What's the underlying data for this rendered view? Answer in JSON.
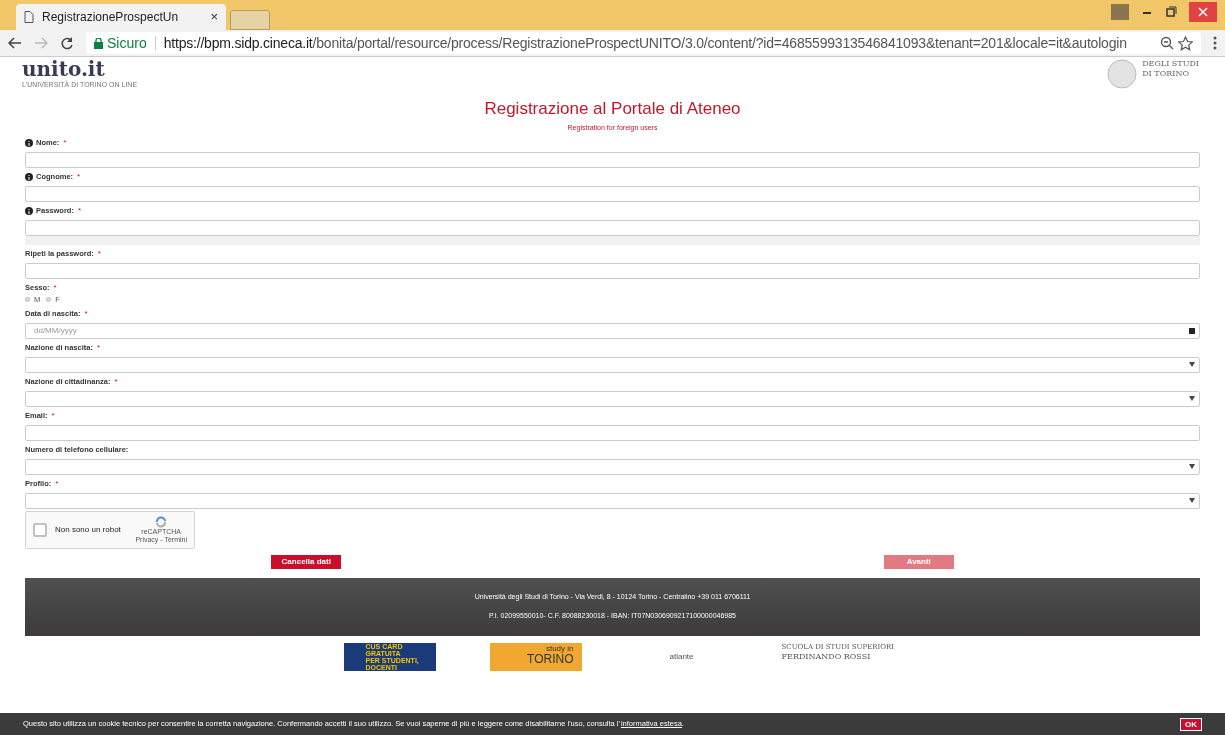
{
  "browser": {
    "tab_title": "RegistrazioneProspectUn",
    "tab_close": "×",
    "secure_label": "Sicuro",
    "url_host": "https://bpm.sidp.cineca.it",
    "url_path": "/bonita/portal/resource/process/RegistrazioneProspectUNITO/3.0/content/?id=4685599313546841093&tenant=201&locale=it&autologin"
  },
  "header": {
    "logo": "unito.it",
    "logo_tagline": "L'UNIVERSITÀ DI TORINO ON LINE",
    "university_lines": [
      "DEGLI STUDI",
      "DI TORINO"
    ]
  },
  "title": "Registrazione al Portale di Ateneo",
  "required_mark": "*",
  "subtitle": "Registration for foreign users",
  "fields": [
    {
      "kind": "text",
      "label": "Nome:",
      "required": true,
      "info": true
    },
    {
      "kind": "text",
      "label": "Cognome:",
      "required": true,
      "info": true
    },
    {
      "kind": "password",
      "label": "Password:",
      "required": true,
      "info": true
    },
    {
      "kind": "text",
      "label": "Ripeti la password:",
      "required": true,
      "info": false
    },
    {
      "kind": "radio",
      "label": "Sesso:",
      "required": true,
      "info": false,
      "options": [
        {
          "label": "M",
          "selected": false
        },
        {
          "label": "F",
          "selected": false
        }
      ]
    },
    {
      "kind": "date",
      "label": "Data di nascita:",
      "required": true,
      "info": false,
      "placeholder": "dd/MM/yyyy"
    },
    {
      "kind": "select",
      "label": "Nazione di nascita:",
      "required": true,
      "info": false
    },
    {
      "kind": "select",
      "label": "Nazione di cittadinanza:",
      "required": true,
      "info": false
    },
    {
      "kind": "text",
      "label": "Email:",
      "required": true,
      "info": false
    },
    {
      "kind": "select",
      "label": "Numero di telefono cellulare:",
      "required": false,
      "info": false
    },
    {
      "kind": "select",
      "label": "Profilo:",
      "required": true,
      "info": false
    }
  ],
  "captcha": {
    "label": "Non sono un robot",
    "checked": false,
    "brand": "reCAPTCHA",
    "links": "Privacy - Termini"
  },
  "buttons": [
    {
      "label": "Cancella dati",
      "disabled": false
    },
    {
      "label": "Avanti",
      "disabled": true
    }
  ],
  "footer": {
    "lines": [
      "Università degli Studi di Torino - Via Verdi, 8 - 10124 Torino - Centralino +39 011 6706111",
      "P.I. 02099550010- C.F. 80088230018 - IBAN: IT07N0306909217100000046985"
    ]
  },
  "partner_logos": [
    {
      "kind": "cus",
      "lines": [
        "CUS CARD",
        "GRATUITA",
        "PER STUDENTI, DOCENTI"
      ]
    },
    {
      "kind": "study",
      "lines": [
        "study in",
        "TORINO"
      ]
    },
    {
      "kind": "atlante",
      "lines": [
        "atlante"
      ]
    },
    {
      "kind": "rossi",
      "lines": [
        "SCUOLA DI STUDI SUPERIORI",
        "FERDINANDO ROSSI"
      ]
    }
  ],
  "cookie_bar": {
    "text": "Questo sito utilizza un cookie tecnico per consentire la corretta navigazione. Confermando accetti il suo utilizzo. Se vuoi saperne di più e leggere come disabilitarne l'uso, consulta l'",
    "link": "informativa estesa",
    "end": ".",
    "ok": "OK"
  }
}
